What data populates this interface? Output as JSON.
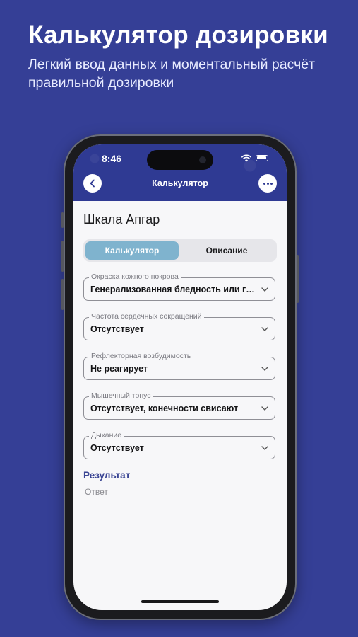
{
  "promo": {
    "title": "Калькулятор дозировки",
    "subtitle": "Легкий ввод данных и моментальный расчёт правильной дозировки"
  },
  "status_bar": {
    "time": "8:46"
  },
  "nav": {
    "title": "Калькулятор",
    "back_icon": "chevron-left-icon",
    "more_icon": "more-horizontal-icon"
  },
  "page": {
    "title": "Шкала Апгар"
  },
  "tabs": [
    {
      "label": "Калькулятор",
      "active": true
    },
    {
      "label": "Описание",
      "active": false
    }
  ],
  "fields": [
    {
      "label": "Окраска кожного покрова",
      "value": "Генерализованная бледность или генерализованный цианоз"
    },
    {
      "label": "Частота сердечных сокращений",
      "value": "Отсутствует"
    },
    {
      "label": "Рефлекторная возбудимость",
      "value": "Не реагирует"
    },
    {
      "label": "Мышечный тонус",
      "value": "Отсутствует, конечности свисают"
    },
    {
      "label": "Дыхание",
      "value": "Отсутствует"
    }
  ],
  "result": {
    "heading": "Результат",
    "placeholder": "Ответ"
  },
  "colors": {
    "background": "#353f96",
    "header": "#2f3a93",
    "active_tab": "#7fb3ce",
    "result_heading": "#3a4594"
  }
}
